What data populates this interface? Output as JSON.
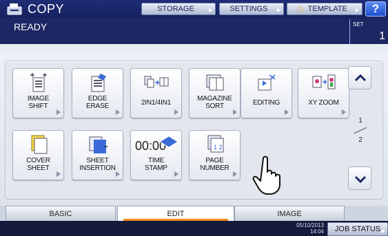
{
  "header": {
    "title": "COPY",
    "buttons": [
      {
        "label": "STORAGE"
      },
      {
        "label": "SETTINGS"
      },
      {
        "label": "TEMPLATE"
      }
    ],
    "help_label": "?"
  },
  "status": {
    "text": "READY",
    "set_label": "SET",
    "set_count": "1"
  },
  "functions": [
    {
      "label": "IMAGE\nSHIFT",
      "icon": "image-shift-icon"
    },
    {
      "label": "EDGE\nERASE",
      "icon": "edge-erase-icon"
    },
    {
      "label": "2IN1/4IN1",
      "icon": "2in1-4in1-icon"
    },
    {
      "label": "MAGAZINE\nSORT",
      "icon": "magazine-sort-icon"
    },
    {
      "label": "EDITING",
      "icon": "editing-icon"
    },
    {
      "label": "XY ZOOM",
      "icon": "xy-zoom-icon"
    },
    {
      "label": "COVER\nSHEET",
      "icon": "cover-sheet-icon"
    },
    {
      "label": "SHEET\nINSERTION",
      "icon": "sheet-insertion-icon"
    },
    {
      "label": "TIME\nSTAMP",
      "icon": "time-stamp-icon",
      "icon_text": "00:00"
    },
    {
      "label": "PAGE\nNUMBER",
      "icon": "page-number-icon"
    }
  ],
  "pager": {
    "current": "1",
    "total": "2"
  },
  "tabs": [
    {
      "label": "BASIC"
    },
    {
      "label": "EDIT",
      "active": true
    },
    {
      "label": "IMAGE"
    }
  ],
  "footer": {
    "date": "05/10/2013",
    "time": "14:04",
    "job_status_label": "JOB STATUS"
  },
  "colors": {
    "header_bg": "#1c2763",
    "accent_active_tab": "#f08a1c",
    "help_button": "#2a5be0"
  }
}
